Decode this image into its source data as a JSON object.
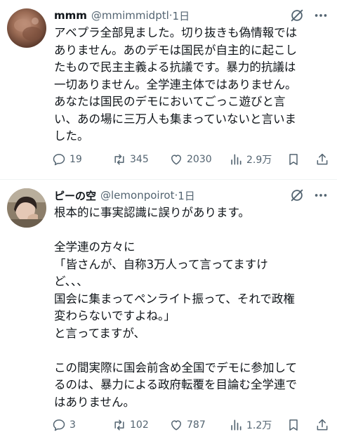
{
  "posts": [
    {
      "name": "mmm",
      "handle": "@mmimmidptl",
      "dot": "·",
      "time": "1日",
      "avatar_icon": "avatar-photo-brown",
      "text": "アベプラ全部見ました。切り抜きも偽情報では\nありません。あのデモは国民が自主的に起こし\nたもので民主主義よる抗議です。暴力的抗議は\n一切ありません。全学連主体ではありません。\nあなたは国民のデモにおいてごっこ遊びと言\nい、あの場に三万人も集まっていないと言いま\nした。",
      "replies": "19",
      "reposts": "345",
      "likes": "2030",
      "views": "2.9万"
    },
    {
      "name": "ピーの空",
      "handle": "@lemonpoirot",
      "dot": "·",
      "time": "1日",
      "avatar_icon": "avatar-photo-person",
      "text": "根本的に事実認識に誤りがあります。\n\n全学連の方々に\n「皆さんが、自称3万人って言ってますけ\nど、、、\n国会に集まってペンライト振って、それで政権\n変わらないですよね。」\nと言ってますが、\n\nこの間実際に国会前含め全国でデモに参加して\nるのは、暴力による政府転覆を目論む全学連で\nはありません。",
      "replies": "3",
      "reposts": "102",
      "likes": "787",
      "views": "1.2万"
    }
  ],
  "colors": {
    "text": "#0f1419",
    "secondary": "#536471",
    "divider": "#eff3f4"
  }
}
